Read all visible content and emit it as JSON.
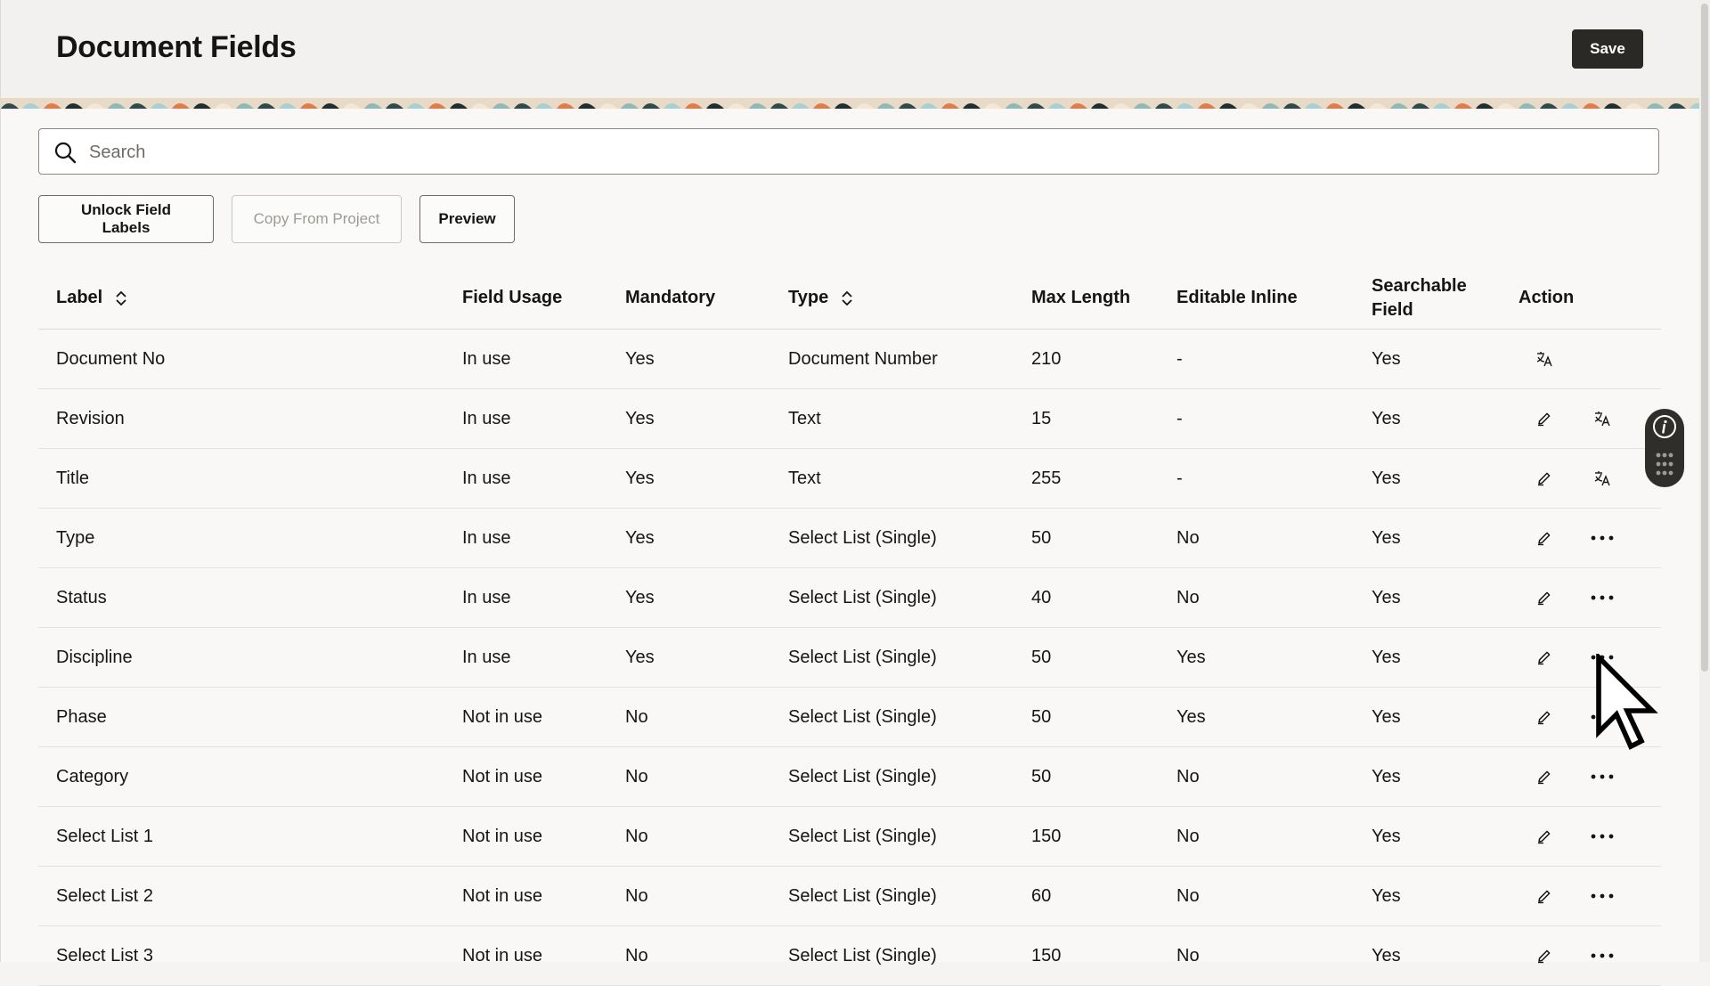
{
  "header": {
    "title": "Document Fields",
    "save_label": "Save"
  },
  "search": {
    "placeholder": "Search",
    "value": ""
  },
  "toolbar": {
    "unlock_label": "Unlock Field Labels",
    "copy_label": "Copy From Project",
    "preview_label": "Preview"
  },
  "table": {
    "columns": {
      "label": "Label",
      "field_usage": "Field Usage",
      "mandatory": "Mandatory",
      "type": "Type",
      "max_length": "Max Length",
      "editable_inline": "Editable Inline",
      "searchable_field_line1": "Searchable",
      "searchable_field_line2": "Field",
      "action": "Action"
    },
    "rows": [
      {
        "label": "Document No",
        "field_usage": "In use",
        "mandatory": "Yes",
        "type": "Document Number",
        "max_length": "210",
        "editable_inline": "-",
        "searchable": "Yes",
        "actions": [
          "translate"
        ]
      },
      {
        "label": "Revision",
        "field_usage": "In use",
        "mandatory": "Yes",
        "type": "Text",
        "max_length": "15",
        "editable_inline": "-",
        "searchable": "Yes",
        "actions": [
          "edit",
          "translate"
        ]
      },
      {
        "label": "Title",
        "field_usage": "In use",
        "mandatory": "Yes",
        "type": "Text",
        "max_length": "255",
        "editable_inline": "-",
        "searchable": "Yes",
        "actions": [
          "edit",
          "translate"
        ]
      },
      {
        "label": "Type",
        "field_usage": "In use",
        "mandatory": "Yes",
        "type": "Select List (Single)",
        "max_length": "50",
        "editable_inline": "No",
        "searchable": "Yes",
        "actions": [
          "edit",
          "more"
        ]
      },
      {
        "label": "Status",
        "field_usage": "In use",
        "mandatory": "Yes",
        "type": "Select List (Single)",
        "max_length": "40",
        "editable_inline": "No",
        "searchable": "Yes",
        "actions": [
          "edit",
          "more"
        ]
      },
      {
        "label": "Discipline",
        "field_usage": "In use",
        "mandatory": "Yes",
        "type": "Select List (Single)",
        "max_length": "50",
        "editable_inline": "Yes",
        "searchable": "Yes",
        "actions": [
          "edit",
          "more"
        ]
      },
      {
        "label": "Phase",
        "field_usage": "Not in use",
        "mandatory": "No",
        "type": "Select List (Single)",
        "max_length": "50",
        "editable_inline": "Yes",
        "searchable": "Yes",
        "actions": [
          "edit",
          "more"
        ]
      },
      {
        "label": "Category",
        "field_usage": "Not in use",
        "mandatory": "No",
        "type": "Select List (Single)",
        "max_length": "50",
        "editable_inline": "No",
        "searchable": "Yes",
        "actions": [
          "edit",
          "more"
        ]
      },
      {
        "label": "Select List 1",
        "field_usage": "Not in use",
        "mandatory": "No",
        "type": "Select List (Single)",
        "max_length": "150",
        "editable_inline": "No",
        "searchable": "Yes",
        "actions": [
          "edit",
          "more"
        ]
      },
      {
        "label": "Select List 2",
        "field_usage": "Not in use",
        "mandatory": "No",
        "type": "Select List (Single)",
        "max_length": "60",
        "editable_inline": "No",
        "searchable": "Yes",
        "actions": [
          "edit",
          "more"
        ]
      },
      {
        "label": "Select List 3",
        "field_usage": "Not in use",
        "mandatory": "No",
        "type": "Select List (Single)",
        "max_length": "150",
        "editable_inline": "No",
        "searchable": "Yes",
        "actions": [
          "edit",
          "more"
        ]
      }
    ]
  },
  "icons": {
    "search": "search-icon",
    "sort": "sort-icon",
    "edit": "pencil-icon",
    "translate": "translate-icon",
    "more": "more-horizontal-icon",
    "info": "info-icon",
    "grip": "grip-icon"
  },
  "colors": {
    "primary_button": "#2a2926",
    "text": "#161513",
    "border": "#6f6c67"
  }
}
